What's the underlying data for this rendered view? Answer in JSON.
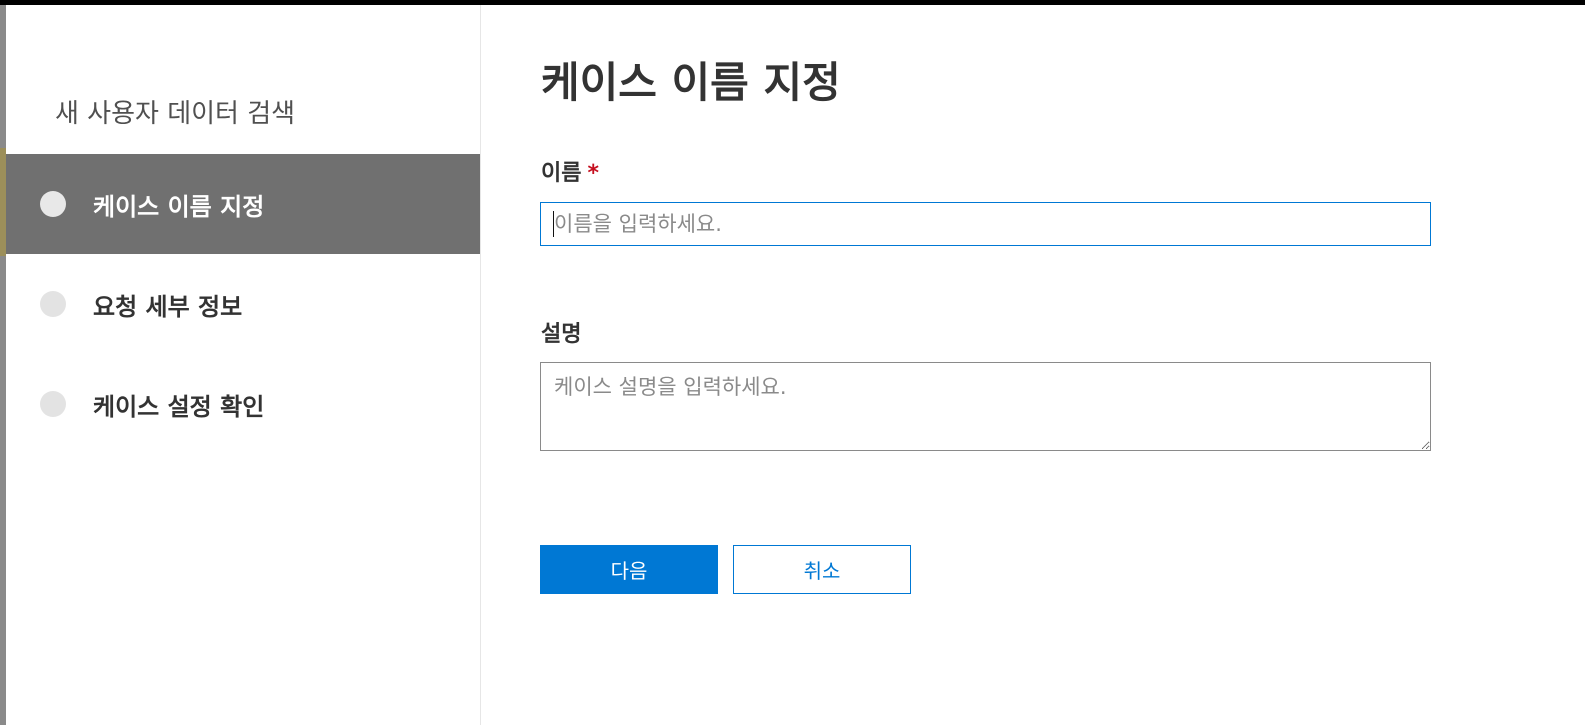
{
  "sidebar": {
    "title": "새 사용자 데이터 검색",
    "steps": [
      {
        "label": "케이스 이름 지정",
        "state": "active"
      },
      {
        "label": "요청 세부 정보",
        "state": "pending"
      },
      {
        "label": "케이스 설정 확인",
        "state": "pending"
      }
    ]
  },
  "main": {
    "title": "케이스 이름 지정",
    "name_field": {
      "label": "이름",
      "required_mark": "*",
      "value": "",
      "placeholder": "이름을 입력하세요."
    },
    "description_field": {
      "label": "설명",
      "value": "",
      "placeholder": "케이스 설명을 입력하세요."
    },
    "buttons": {
      "next_label": "다음",
      "cancel_label": "취소"
    }
  },
  "colors": {
    "accent": "#0078d4",
    "active_step_bg": "#707070",
    "required": "#c50f1f"
  }
}
